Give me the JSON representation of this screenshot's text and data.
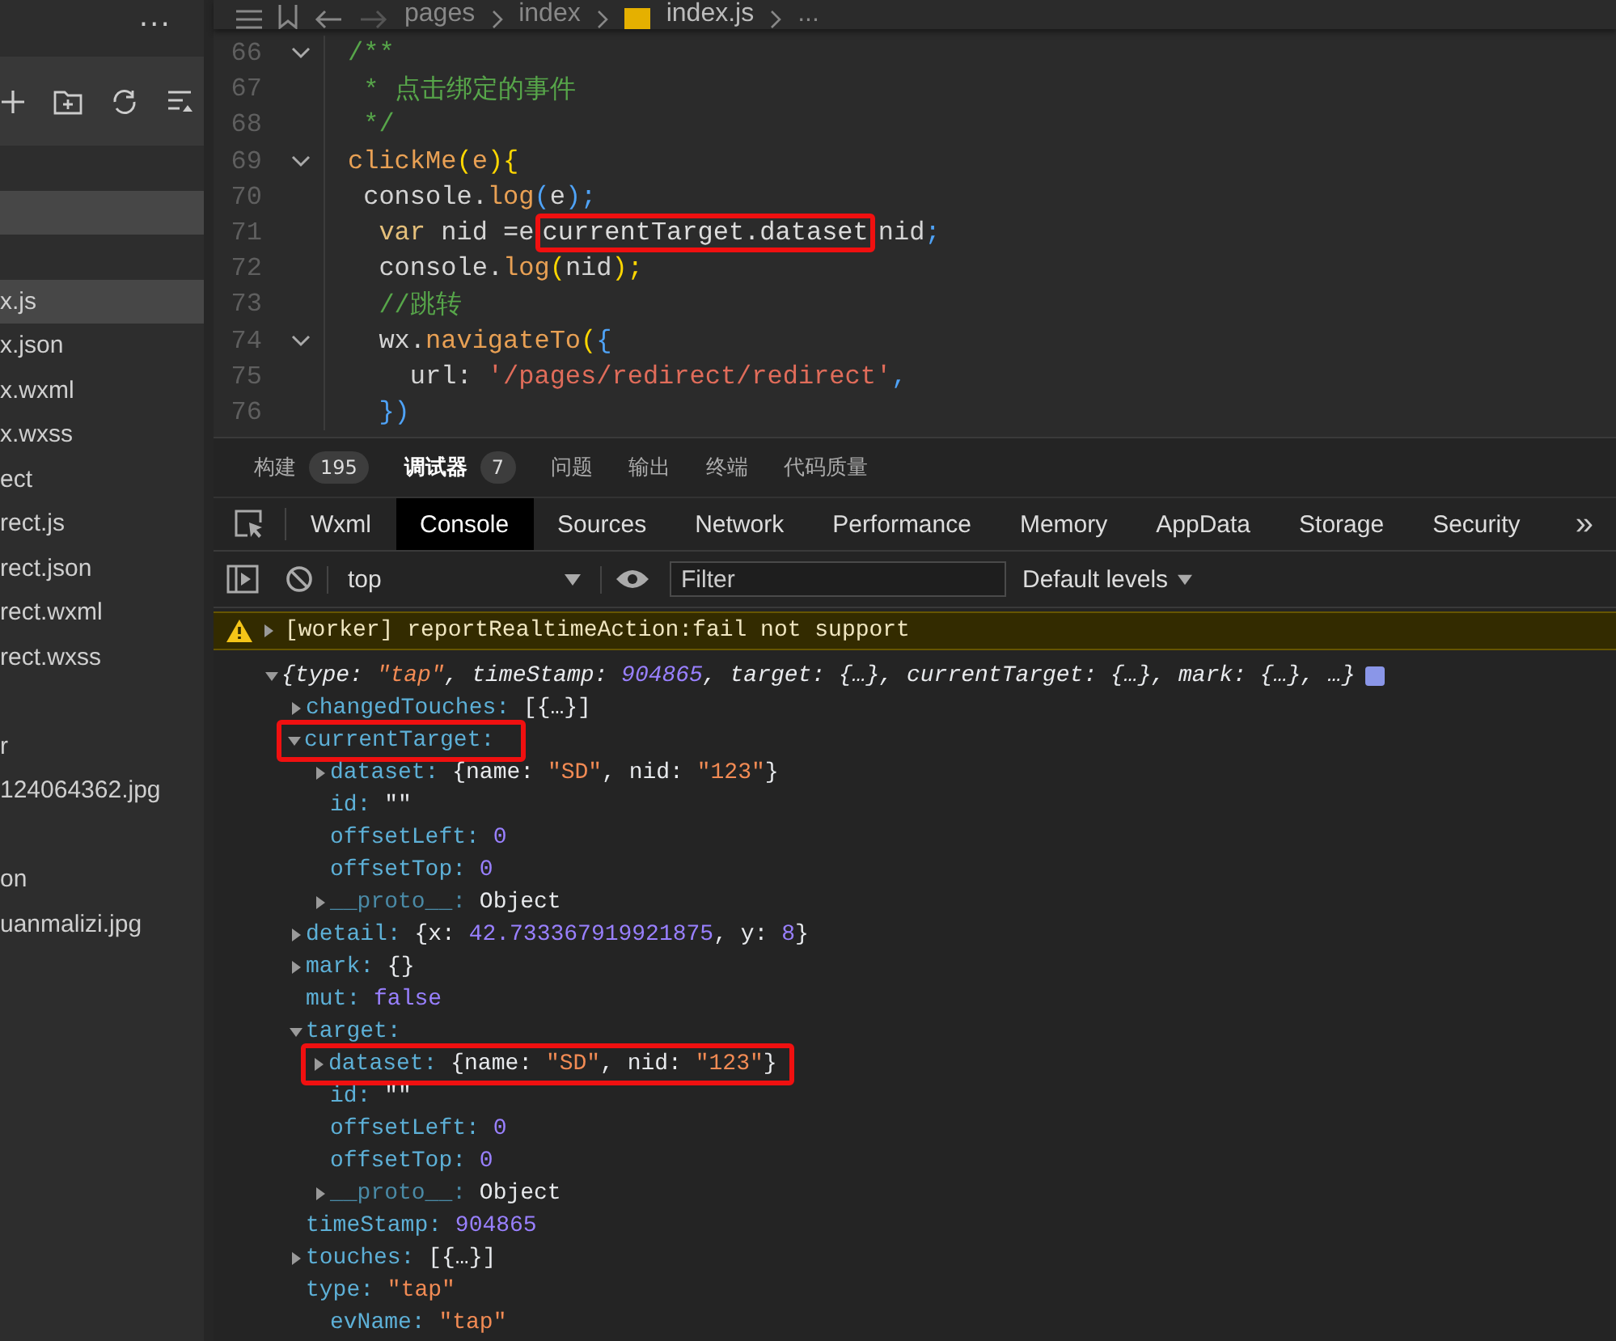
{
  "sidebar": {
    "more": "...",
    "items": [
      {
        "kind": "spacer"
      },
      {
        "kind": "file",
        "selected": true
      },
      {
        "kind": "spacer"
      },
      {
        "kind": "file",
        "label": "x.js",
        "selected": true
      },
      {
        "kind": "file",
        "label": "x.json",
        "selected": false
      },
      {
        "kind": "file",
        "label": "x.wxml",
        "selected": false
      },
      {
        "kind": "file",
        "label": "x.wxss",
        "selected": false
      },
      {
        "kind": "file",
        "label": "ect",
        "selected": false
      },
      {
        "kind": "file",
        "label": "rect.js",
        "selected": false
      },
      {
        "kind": "file",
        "label": "rect.json",
        "selected": false
      },
      {
        "kind": "file",
        "label": "rect.wxml",
        "selected": false
      },
      {
        "kind": "file",
        "label": "rect.wxss",
        "selected": false
      },
      {
        "kind": "spacer"
      },
      {
        "kind": "file",
        "label": "r",
        "selected": false
      },
      {
        "kind": "file",
        "label": "124064362.jpg",
        "selected": false
      },
      {
        "kind": "spacer"
      },
      {
        "kind": "file",
        "label": "on",
        "selected": false
      },
      {
        "kind": "file",
        "label": "uanmalizi.jpg",
        "selected": false
      }
    ]
  },
  "breadcrumb": {
    "parts": [
      "pages",
      "index",
      "index.js",
      "..."
    ]
  },
  "editor": {
    "lines": [
      {
        "n": "66",
        "foldable": true,
        "tokens": [
          {
            "t": "/**",
            "kind": "comment"
          }
        ]
      },
      {
        "n": "67",
        "foldable": false,
        "tokens": [
          {
            "t": " * 点击绑定的事件",
            "kind": "comment"
          }
        ]
      },
      {
        "n": "68",
        "foldable": false,
        "tokens": [
          {
            "t": " */",
            "kind": "comment"
          }
        ]
      },
      {
        "n": "69",
        "foldable": true,
        "tokens": [
          {
            "t": "clickMe",
            "kind": "func"
          },
          {
            "t": "(",
            "kind": "b1"
          },
          {
            "t": "e",
            "kind": "param"
          },
          {
            "t": ")",
            "kind": "b1"
          },
          {
            "t": "{",
            "kind": "b1"
          }
        ]
      },
      {
        "n": "70",
        "foldable": false,
        "tokens": [
          {
            "t": " console.",
            "kind": "plain"
          },
          {
            "t": "log",
            "kind": "func"
          },
          {
            "t": "(",
            "kind": "b2"
          },
          {
            "t": "e",
            "kind": "plain"
          },
          {
            "t": ");",
            "kind": "b2"
          }
        ]
      },
      {
        "n": "71",
        "foldable": false,
        "tokens": [
          {
            "t": "  var",
            "kind": "keyword"
          },
          {
            "t": " nid =e",
            "kind": "plain"
          },
          {
            "t": "currentTarget.dataset",
            "kind": "boxed"
          },
          {
            "t": "nid",
            "kind": "plain"
          },
          {
            "t": ";",
            "kind": "b2"
          }
        ]
      },
      {
        "n": "72",
        "foldable": false,
        "tokens": [
          {
            "t": "  console.",
            "kind": "plain"
          },
          {
            "t": "log",
            "kind": "func"
          },
          {
            "t": "(",
            "kind": "b1"
          },
          {
            "t": "nid",
            "kind": "plain"
          },
          {
            "t": ");",
            "kind": "b1"
          }
        ]
      },
      {
        "n": "73",
        "foldable": false,
        "tokens": [
          {
            "t": "  //跳转",
            "kind": "comment"
          }
        ]
      },
      {
        "n": "74",
        "foldable": true,
        "tokens": [
          {
            "t": "  wx.",
            "kind": "plain"
          },
          {
            "t": "navigateTo",
            "kind": "func"
          },
          {
            "t": "(",
            "kind": "b1"
          },
          {
            "t": "{",
            "kind": "b2"
          }
        ]
      },
      {
        "n": "75",
        "foldable": false,
        "tokens": [
          {
            "t": "    url: ",
            "kind": "plain"
          },
          {
            "t": "'/pages/redirect/redirect'",
            "kind": "string"
          },
          {
            "t": ",",
            "kind": "b2"
          }
        ]
      },
      {
        "n": "76",
        "foldable": false,
        "tokens": [
          {
            "t": "  })",
            "kind": "b2"
          }
        ]
      }
    ]
  },
  "panel_tabs": [
    {
      "label": "构建",
      "badge": "195",
      "selected": false
    },
    {
      "label": "调试器",
      "badge": "7",
      "selected": true
    },
    {
      "label": "问题",
      "selected": false
    },
    {
      "label": "输出",
      "selected": false
    },
    {
      "label": "终端",
      "selected": false
    },
    {
      "label": "代码质量",
      "selected": false
    }
  ],
  "devtools_tabs": [
    {
      "label": "Wxml",
      "selected": false
    },
    {
      "label": "Console",
      "selected": true
    },
    {
      "label": "Sources",
      "selected": false
    },
    {
      "label": "Network",
      "selected": false
    },
    {
      "label": "Performance",
      "selected": false
    },
    {
      "label": "Memory",
      "selected": false
    },
    {
      "label": "AppData",
      "selected": false
    },
    {
      "label": "Storage",
      "selected": false
    },
    {
      "label": "Security",
      "selected": false
    }
  ],
  "devtools_more": "»",
  "console_toolbar": {
    "context": "top",
    "filter": {
      "placeholder": "Filter"
    },
    "levels": "Default levels"
  },
  "warning": {
    "expanded": false,
    "text": "[worker] reportRealtimeAction:fail not support"
  },
  "log": {
    "expanded": true,
    "summary": [
      {
        "t": "{type: ",
        "kind": "p"
      },
      {
        "t": "\"tap\"",
        "kind": "s"
      },
      {
        "t": ", timeStamp: ",
        "kind": "p"
      },
      {
        "t": "904865",
        "kind": "n"
      },
      {
        "t": ", target: {…}, currentTarget: {…}, mark: {…}, …}",
        "kind": "p"
      }
    ],
    "children": [
      {
        "key": "changedTouches:",
        "expanded": false,
        "value": [
          {
            "t": "[{…}]",
            "kind": "p"
          }
        ]
      },
      {
        "key": "currentTarget:",
        "expanded": true,
        "boxed": true,
        "children": [
          {
            "key": "dataset:",
            "expanded": false,
            "value": [
              {
                "t": "{name: ",
                "kind": "p"
              },
              {
                "t": "\"SD\"",
                "kind": "s"
              },
              {
                "t": ", nid: ",
                "kind": "p"
              },
              {
                "t": "\"123\"",
                "kind": "s"
              },
              {
                "t": "}",
                "kind": "p"
              }
            ]
          },
          {
            "key": "id:",
            "value": [
              {
                "t": "\"\"",
                "kind": "p"
              }
            ]
          },
          {
            "key": "offsetLeft:",
            "value": [
              {
                "t": "0",
                "kind": "n"
              }
            ]
          },
          {
            "key": "offsetTop:",
            "value": [
              {
                "t": "0",
                "kind": "n"
              }
            ]
          },
          {
            "key": "__proto__:",
            "dim": true,
            "expanded": false,
            "value": [
              {
                "t": "Object",
                "kind": "p"
              }
            ]
          }
        ]
      },
      {
        "key": "detail:",
        "expanded": false,
        "value": [
          {
            "t": "{x: ",
            "kind": "p"
          },
          {
            "t": "42.733367919921875",
            "kind": "n"
          },
          {
            "t": ", y: ",
            "kind": "p"
          },
          {
            "t": "8",
            "kind": "n"
          },
          {
            "t": "}",
            "kind": "p"
          }
        ]
      },
      {
        "key": "mark:",
        "expanded": false,
        "value": [
          {
            "t": "{}",
            "kind": "p"
          }
        ]
      },
      {
        "key": "mut:",
        "value": [
          {
            "t": "false",
            "kind": "n"
          }
        ]
      },
      {
        "key": "target:",
        "expanded": true,
        "children": [
          {
            "key": "dataset:",
            "expanded": false,
            "boxed": true,
            "value": [
              {
                "t": "{name: ",
                "kind": "p"
              },
              {
                "t": "\"SD\"",
                "kind": "s"
              },
              {
                "t": ", nid: ",
                "kind": "p"
              },
              {
                "t": "\"123\"",
                "kind": "s"
              },
              {
                "t": "}",
                "kind": "p"
              }
            ]
          },
          {
            "key": "id:",
            "value": [
              {
                "t": "\"\"",
                "kind": "p"
              }
            ]
          },
          {
            "key": "offsetLeft:",
            "value": [
              {
                "t": "0",
                "kind": "n"
              }
            ]
          },
          {
            "key": "offsetTop:",
            "value": [
              {
                "t": "0",
                "kind": "n"
              }
            ]
          },
          {
            "key": "__proto__:",
            "dim": true,
            "expanded": false,
            "value": [
              {
                "t": "Object",
                "kind": "p"
              }
            ]
          }
        ]
      },
      {
        "key": "timeStamp:",
        "value": [
          {
            "t": "904865",
            "kind": "n"
          }
        ]
      },
      {
        "key": "touches:",
        "expanded": false,
        "value": [
          {
            "t": "[{…}]",
            "kind": "p"
          }
        ]
      },
      {
        "key": "type:",
        "value": [
          {
            "t": "\"tap\"",
            "kind": "s"
          }
        ],
        "children": [
          {
            "key": "evName:",
            "value": [
              {
                "t": "\"tap\"",
                "kind": "s"
              }
            ]
          }
        ]
      }
    ]
  }
}
